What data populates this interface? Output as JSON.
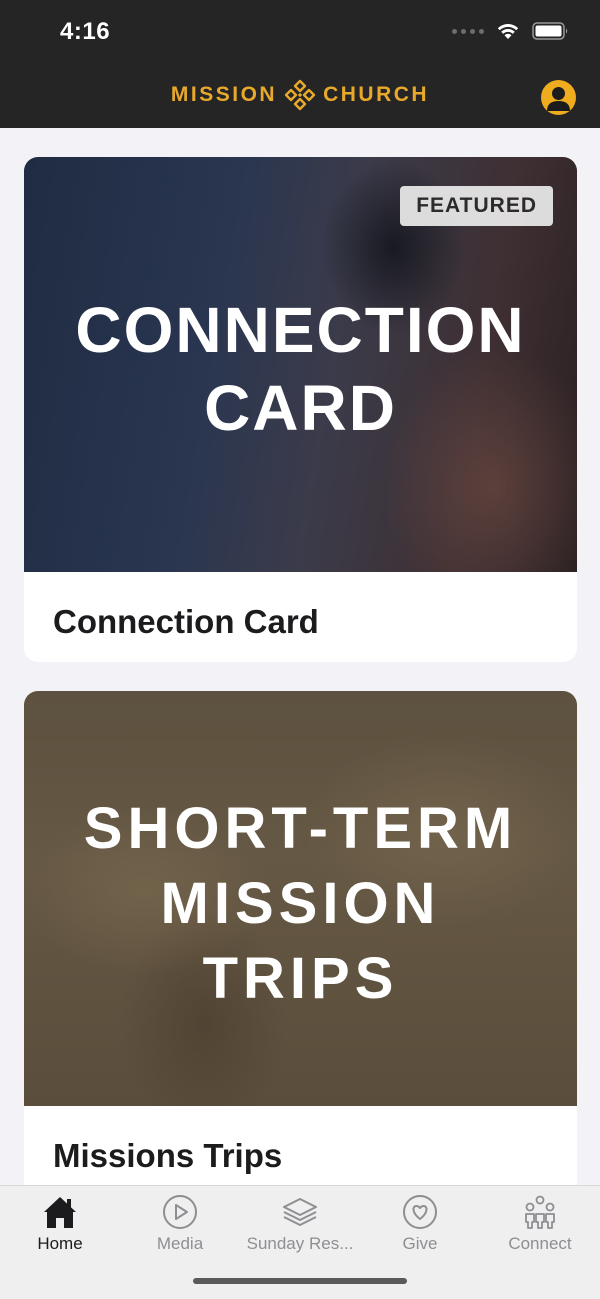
{
  "status": {
    "time": "4:16"
  },
  "header": {
    "brand_left": "MISSION",
    "brand_right": "CHURCH",
    "brand_color": "#e8a92b",
    "profile_icon": "person-circle-icon"
  },
  "cards": [
    {
      "image_text": "CONNECTION\nCARD",
      "badge": "FEATURED",
      "title": "Connection Card"
    },
    {
      "image_text": "SHORT-TERM\nMISSION\nTRIPS",
      "title": "Missions Trips"
    }
  ],
  "tabs": [
    {
      "label": "Home",
      "icon": "house-icon",
      "active": true
    },
    {
      "label": "Media",
      "icon": "play-circle-icon",
      "active": false
    },
    {
      "label": "Sunday Res...",
      "icon": "layers-icon",
      "active": false
    },
    {
      "label": "Give",
      "icon": "heart-circle-icon",
      "active": false
    },
    {
      "label": "Connect",
      "icon": "people-icon",
      "active": false
    }
  ]
}
